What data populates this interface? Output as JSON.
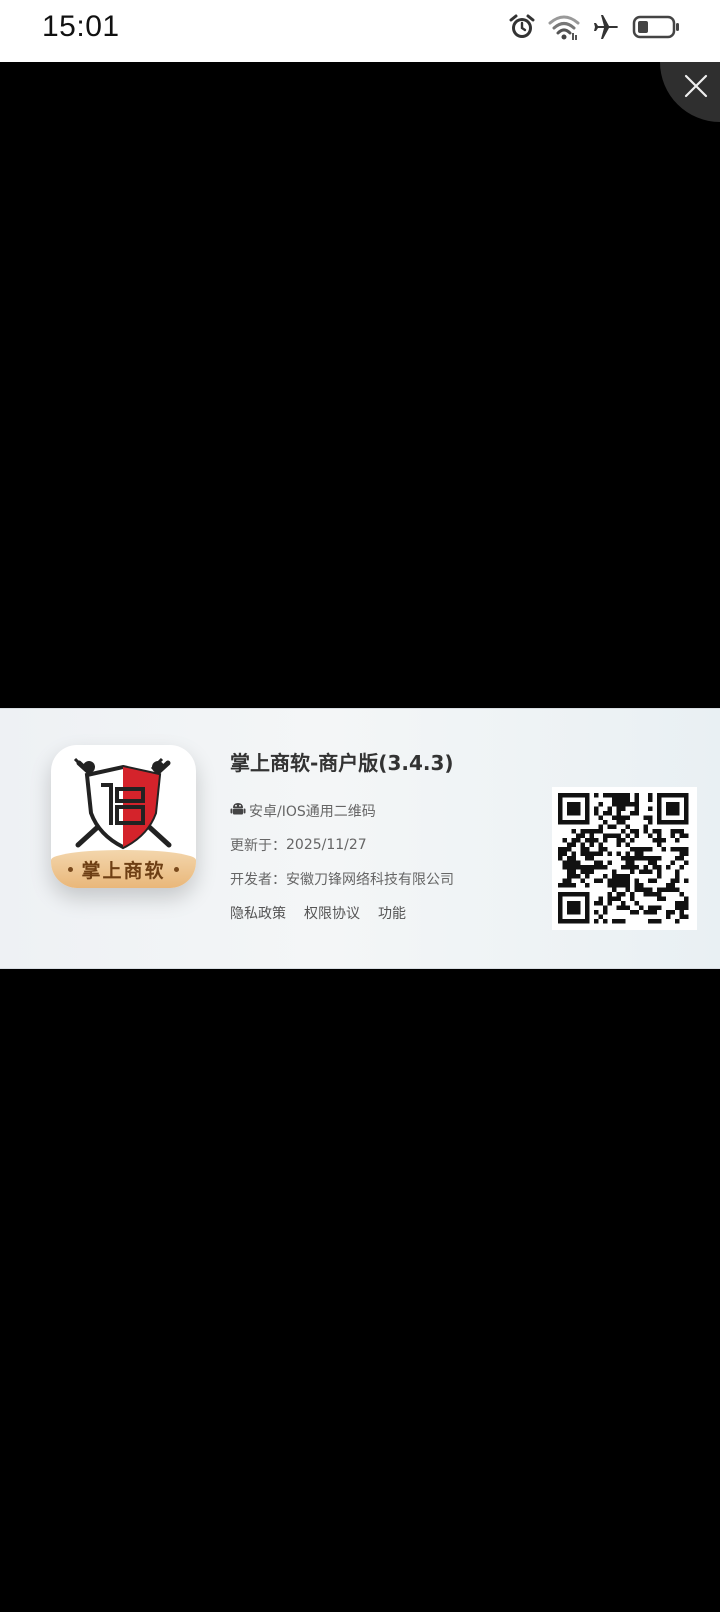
{
  "status_bar": {
    "time": "15:01",
    "icons": [
      "alarm-icon",
      "wifi-icon",
      "airplane-mode-icon",
      "battery-icon"
    ]
  },
  "viewer": {
    "close_icon": "close-icon"
  },
  "banner": {
    "app_icon_text": "掌上商软",
    "app_title": "掌上商软-商户版(3.4.3)",
    "platform_label": "安卓/IOS通用二维码",
    "updated_label": "更新于：",
    "updated_date": "2025/11/27",
    "developer_label": "开发者：",
    "developer_name": "安徽刀锋网络科技有限公司",
    "links": {
      "privacy": "隐私政策",
      "permissions": "权限协议",
      "features": "功能"
    },
    "qr_icon": "qr-code"
  },
  "colors": {
    "viewer_bg": "#000000",
    "banner_bg": "#eef1f4",
    "ribbon": "#e9b77a",
    "accent_red": "#d4232b"
  }
}
